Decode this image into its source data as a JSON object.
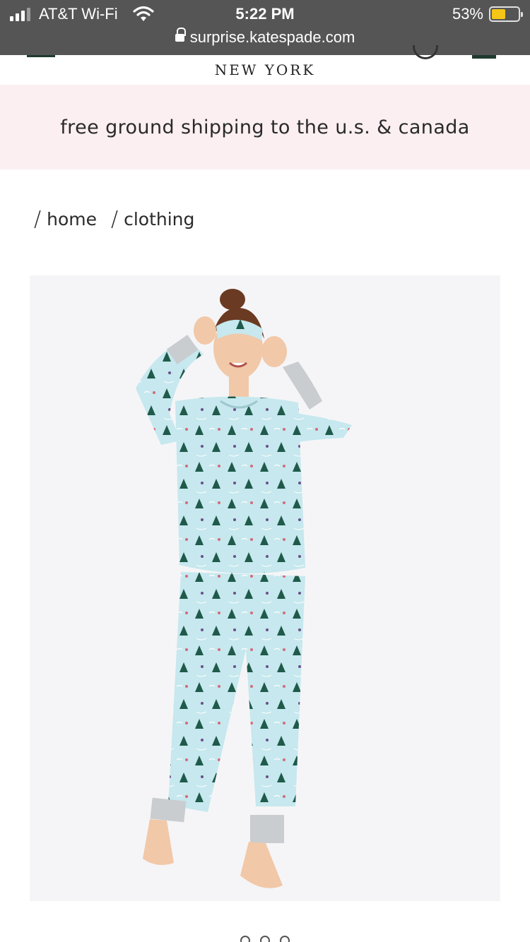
{
  "status_bar": {
    "carrier": "AT&T Wi-Fi",
    "time": "5:22 PM",
    "battery_percent": "53%",
    "battery_level": 0.53,
    "url": "surprise.katespade.com"
  },
  "header": {
    "brand_sub": "NEW YORK"
  },
  "promo": {
    "text": "free ground shipping to the u.s. & canada"
  },
  "breadcrumb": {
    "separator": "/",
    "items": [
      {
        "label": "home"
      },
      {
        "label": "clothing"
      }
    ]
  },
  "product": {
    "image_alt": "model wearing light blue printed pajama set with sleep mask",
    "colors": {
      "pajama": "#c6e8ee",
      "tree": "#1f5a4a",
      "cuff": "#c9cdd0",
      "background": "#f5f5f7"
    }
  },
  "carousel": {
    "dot_count": 3
  },
  "colors": {
    "status_bar_bg": "#555555",
    "promo_bg": "#fbeff2",
    "brand_green": "#1f3b2e"
  }
}
